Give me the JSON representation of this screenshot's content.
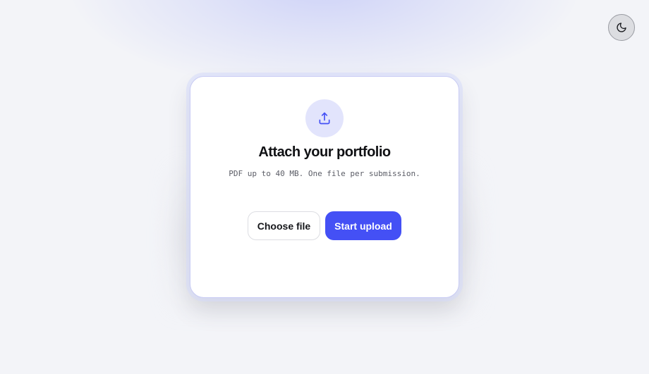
{
  "header": {
    "theme_toggle_icon": "moon-icon"
  },
  "card": {
    "icon": "upload-icon",
    "title": "Attach your portfolio",
    "subtitle": "PDF up to 40 MB. One file per submission.",
    "choose_label": "Choose file",
    "upload_label": "Start upload"
  },
  "colors": {
    "accent": "#4450f5",
    "icon_circle": "#e2e4fc",
    "background": "#f3f4f8"
  }
}
